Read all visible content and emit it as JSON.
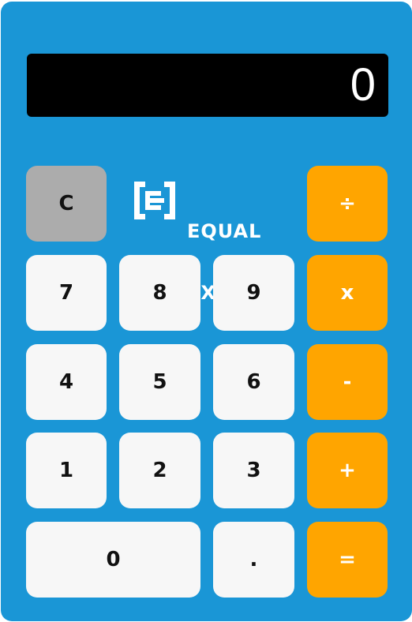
{
  "display": {
    "value": "0"
  },
  "logo": {
    "line1": "EQUAL",
    "line2": "EXPERTS",
    "icon": "equal-experts-logo-mark"
  },
  "keys": {
    "clear": "C",
    "divide": "÷",
    "multiply": "x",
    "subtract": "-",
    "add": "+",
    "equals": "=",
    "seven": "7",
    "eight": "8",
    "nine": "9",
    "four": "4",
    "five": "5",
    "six": "6",
    "one": "1",
    "two": "2",
    "three": "3",
    "zero": "0",
    "decimal": "."
  },
  "colors": {
    "body": "#1a96d6",
    "display_bg": "#000000",
    "number_key": "#f7f7f7",
    "clear_key": "#acacac",
    "operator_key": "#ffa500"
  }
}
